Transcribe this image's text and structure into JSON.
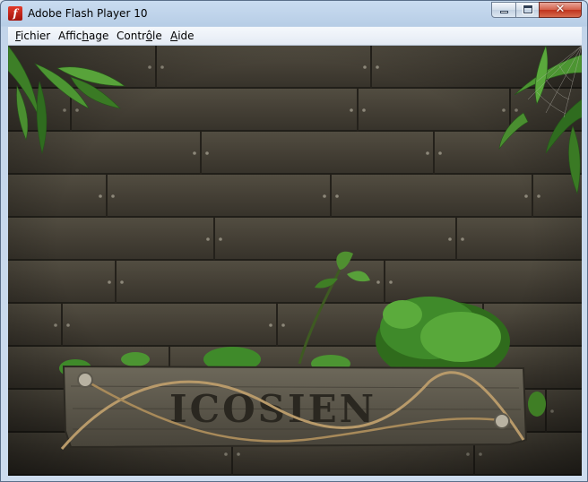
{
  "window": {
    "title": "Adobe Flash Player 10",
    "app_icon_glyph": "f",
    "controls": {
      "minimize": "minimize-icon",
      "maximize": "maximize-icon",
      "close": "close-icon",
      "close_glyph": "✕"
    }
  },
  "menu": {
    "items": [
      {
        "label": "Fichier",
        "underline_index": 0
      },
      {
        "label": "Affichage",
        "underline_index": 5
      },
      {
        "label": "Contrôle",
        "underline_index": 5
      },
      {
        "label": "Aide",
        "underline_index": 0
      }
    ]
  },
  "content": {
    "sign_text": "ICOSIEN",
    "colors": {
      "wood_dark": "#2f2c24",
      "wood_mid": "#4a463b",
      "leaf": "#3f8a2a",
      "sign": "#5d594c",
      "rope": "#b89a6a"
    }
  }
}
